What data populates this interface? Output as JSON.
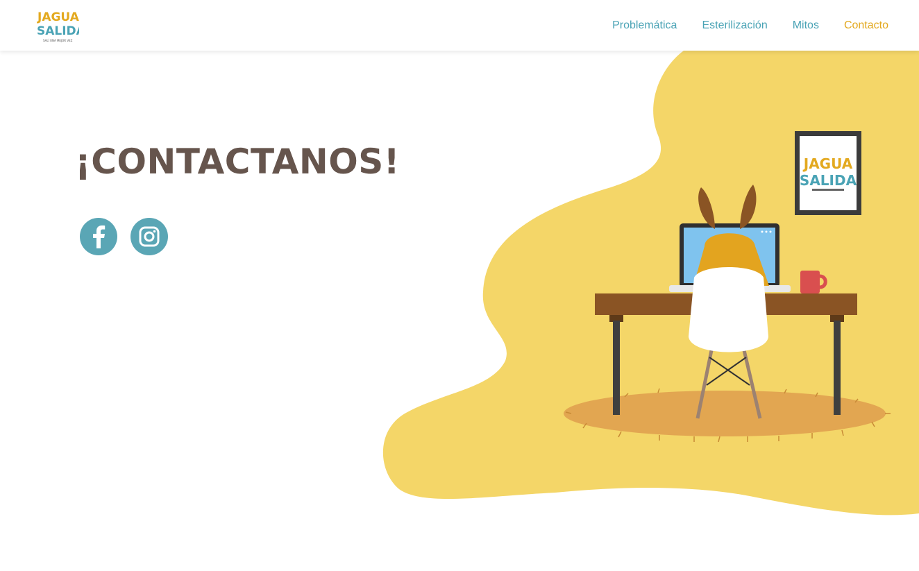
{
  "brand": {
    "logo_line1": "JAGUA",
    "logo_line2": "SALIDA",
    "tagline": "SALÍ UNA MEJOR VEZ"
  },
  "nav": {
    "items": [
      {
        "label": "Problemática",
        "active": false
      },
      {
        "label": "Esterilización",
        "active": false
      },
      {
        "label": "Mitos",
        "active": false
      },
      {
        "label": "Contacto",
        "active": true
      }
    ]
  },
  "hero": {
    "title": "¡CONTACTANOS!"
  },
  "social": [
    {
      "name": "facebook",
      "icon": "facebook-icon"
    },
    {
      "name": "instagram",
      "icon": "instagram-icon"
    }
  ],
  "colors": {
    "accent_teal": "#4aa3b5",
    "accent_yellow": "#e3a91f",
    "title_brown": "#66554d",
    "blob_yellow": "#f4d668"
  }
}
